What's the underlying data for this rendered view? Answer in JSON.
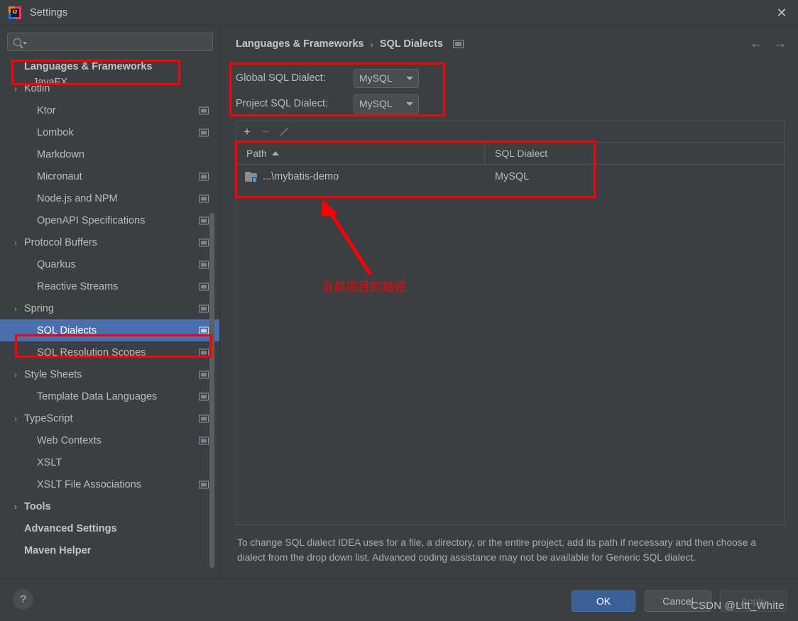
{
  "window": {
    "title": "Settings",
    "app_icon": "intellij-idea-icon",
    "close_icon": "close-icon"
  },
  "sidebar": {
    "search": {
      "value": "",
      "placeholder": "",
      "icon": "search-icon",
      "caret_icon": "chevron-down-icon"
    },
    "ghost_item": "JavaFX",
    "items": [
      {
        "label": "Languages & Frameworks",
        "level": 0,
        "chevron": "",
        "bold": true,
        "badge": false,
        "selected": false
      },
      {
        "label": "Kotlin",
        "level": 0,
        "chevron": "›",
        "bold": false,
        "badge": false,
        "selected": false
      },
      {
        "label": "Ktor",
        "level": 1,
        "chevron": "",
        "bold": false,
        "badge": true,
        "selected": false
      },
      {
        "label": "Lombok",
        "level": 1,
        "chevron": "",
        "bold": false,
        "badge": true,
        "selected": false
      },
      {
        "label": "Markdown",
        "level": 1,
        "chevron": "",
        "bold": false,
        "badge": false,
        "selected": false
      },
      {
        "label": "Micronaut",
        "level": 1,
        "chevron": "",
        "bold": false,
        "badge": true,
        "selected": false
      },
      {
        "label": "Node.js and NPM",
        "level": 1,
        "chevron": "",
        "bold": false,
        "badge": true,
        "selected": false
      },
      {
        "label": "OpenAPI Specifications",
        "level": 1,
        "chevron": "",
        "bold": false,
        "badge": true,
        "selected": false
      },
      {
        "label": "Protocol Buffers",
        "level": 0,
        "chevron": "›",
        "bold": false,
        "badge": true,
        "selected": false
      },
      {
        "label": "Quarkus",
        "level": 1,
        "chevron": "",
        "bold": false,
        "badge": true,
        "selected": false
      },
      {
        "label": "Reactive Streams",
        "level": 1,
        "chevron": "",
        "bold": false,
        "badge": true,
        "selected": false
      },
      {
        "label": "Spring",
        "level": 0,
        "chevron": "›",
        "bold": false,
        "badge": true,
        "selected": false
      },
      {
        "label": "SQL Dialects",
        "level": 1,
        "chevron": "",
        "bold": false,
        "badge": true,
        "selected": true
      },
      {
        "label": "SQL Resolution Scopes",
        "level": 1,
        "chevron": "",
        "bold": false,
        "badge": true,
        "selected": false
      },
      {
        "label": "Style Sheets",
        "level": 0,
        "chevron": "›",
        "bold": false,
        "badge": true,
        "selected": false
      },
      {
        "label": "Template Data Languages",
        "level": 1,
        "chevron": "",
        "bold": false,
        "badge": true,
        "selected": false
      },
      {
        "label": "TypeScript",
        "level": 0,
        "chevron": "›",
        "bold": false,
        "badge": true,
        "selected": false
      },
      {
        "label": "Web Contexts",
        "level": 1,
        "chevron": "",
        "bold": false,
        "badge": true,
        "selected": false
      },
      {
        "label": "XSLT",
        "level": 1,
        "chevron": "",
        "bold": false,
        "badge": false,
        "selected": false
      },
      {
        "label": "XSLT File Associations",
        "level": 1,
        "chevron": "",
        "bold": false,
        "badge": true,
        "selected": false
      },
      {
        "label": "Tools",
        "level": 0,
        "chevron": "›",
        "bold": true,
        "badge": false,
        "selected": false
      },
      {
        "label": "Advanced Settings",
        "level": 0,
        "chevron": "",
        "bold": true,
        "badge": false,
        "selected": false
      },
      {
        "label": "Maven Helper",
        "level": 0,
        "chevron": "",
        "bold": true,
        "badge": false,
        "selected": false
      }
    ]
  },
  "main": {
    "breadcrumb": {
      "root": "Languages & Frameworks",
      "separator": "›",
      "current": "SQL Dialects",
      "badge_icon": "project-scope-badge-icon"
    },
    "nav": {
      "back_icon": "←",
      "forward_icon": "→"
    },
    "global_dialect": {
      "label": "Global SQL Dialect:",
      "value": "MySQL"
    },
    "project_dialect": {
      "label": "Project SQL Dialect:",
      "value": "MySQL"
    },
    "toolbar": {
      "add": "+",
      "remove": "−",
      "edit_icon": "pencil-icon"
    },
    "table": {
      "columns": [
        "Path",
        "SQL Dialect"
      ],
      "sort_column": "Path",
      "sort_direction": "asc",
      "rows": [
        {
          "path": "...\\mybatis-demo",
          "dialect": "MySQL",
          "icon": "folder-icon"
        }
      ]
    },
    "hint": "To change SQL dialect IDEA uses for a file, a directory, or the entire project, add its path if necessary and then choose a dialect from the drop down list. Advanced coding assistance may not be available for Generic SQL dialect."
  },
  "footer": {
    "help_label": "?",
    "ok": "OK",
    "cancel": "Cancel",
    "apply": "Apply"
  },
  "annotations": {
    "arrow_note": "当前项目的路径",
    "color": "#fb0007"
  },
  "watermark": "CSDN @Litt_White"
}
